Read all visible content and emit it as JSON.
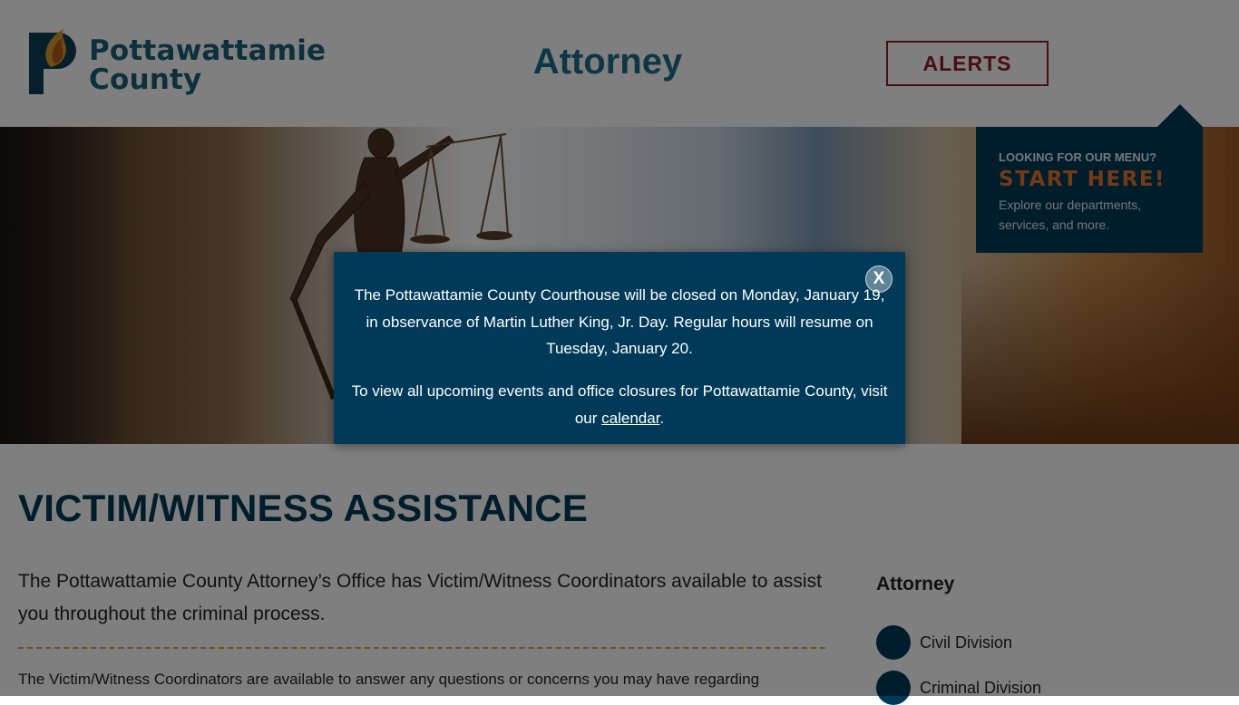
{
  "header": {
    "logo_line1": "Pottawattamie",
    "logo_line2": "County",
    "site_title": "Attorney",
    "alerts_label": "ALERTS"
  },
  "menu_panel": {
    "question": "LOOKING FOR OUR MENU?",
    "cta": "START HERE!",
    "description": "Explore our departments, services, and more."
  },
  "main": {
    "heading": "VICTIM/WITNESS ASSISTANCE",
    "intro": "The Pottawattamie County Attorney’s Office has Victim/Witness Coordinators available to assist you throughout the criminal process.",
    "body": "The Victim/Witness Coordinators are available to answer any questions or concerns you may have regarding"
  },
  "sidebar": {
    "title": "Attorney",
    "items": [
      {
        "label": "Civil Division"
      },
      {
        "label": "Criminal Division"
      }
    ]
  },
  "modal": {
    "paragraph1": "The Pottawattamie County Courthouse will be closed on Monday, January 19, in observance of Martin Luther King, Jr. Day. Regular hours will resume on Tuesday, January 20.",
    "paragraph2_prefix": "To view all upcoming events and office closures for Pottawattamie County, visit our ",
    "paragraph2_link": "calendar",
    "paragraph2_suffix": ".",
    "close_label": "X"
  },
  "colors": {
    "primary_navy": "#003a58",
    "logo_teal": "#1a6178",
    "alert_red": "#8e1f23",
    "accent_orange": "#e8752a",
    "divider_gold": "#d9a53b"
  },
  "icons": {
    "logo": "county-p-flame-logo",
    "close": "close-icon",
    "sidebar_bullet": "circle-bullet-icon"
  }
}
